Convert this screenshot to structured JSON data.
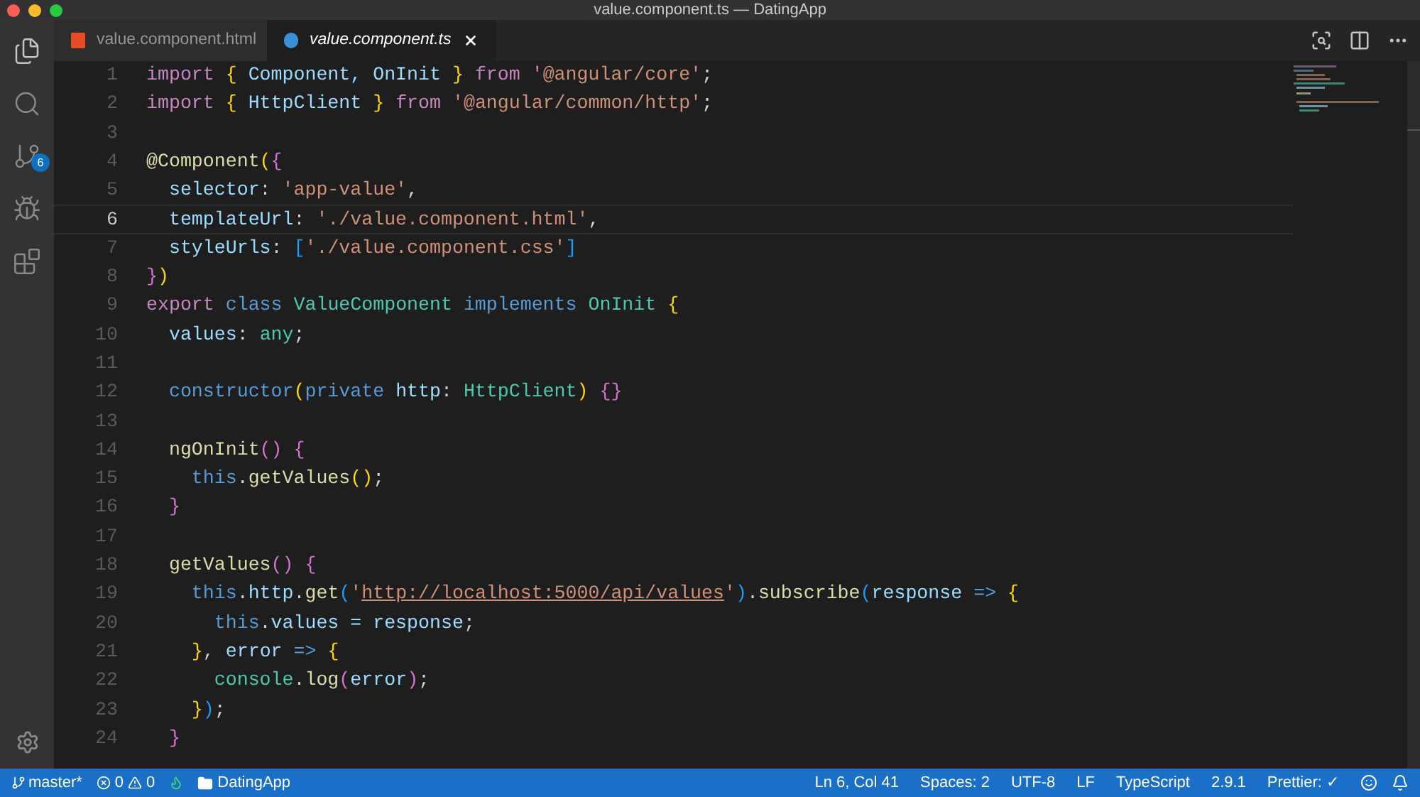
{
  "window": {
    "title": "value.component.ts — DatingApp"
  },
  "activity_bar": {
    "source_control_badge": "6"
  },
  "tabs": [
    {
      "label": "value.component.html",
      "kind": "html",
      "selected": false
    },
    {
      "label": "value.component.ts",
      "kind": "angular",
      "selected": true
    }
  ],
  "editor": {
    "lines": [
      {
        "number": "1",
        "active": false,
        "tokens": [
          {
            "t": "import ",
            "kind": "kw"
          },
          {
            "t": "{ ",
            "kind": "y"
          },
          {
            "t": "Component, OnInit ",
            "kind": "id"
          },
          {
            "t": "} ",
            "kind": "y"
          },
          {
            "t": "from ",
            "kind": "kw"
          },
          {
            "t": "'@angular/core'",
            "kind": "s"
          },
          {
            "t": ";",
            "kind": "p"
          }
        ]
      },
      {
        "number": "2",
        "active": false,
        "tokens": [
          {
            "t": "import ",
            "kind": "kw"
          },
          {
            "t": "{ ",
            "kind": "y"
          },
          {
            "t": "HttpClient ",
            "kind": "id"
          },
          {
            "t": "} ",
            "kind": "y"
          },
          {
            "t": "from ",
            "kind": "kw"
          },
          {
            "t": "'@angular/common/http'",
            "kind": "s"
          },
          {
            "t": ";",
            "kind": "p"
          }
        ]
      },
      {
        "number": "3",
        "active": false
      },
      {
        "number": "4",
        "active": false,
        "tokens": [
          {
            "t": "@Component",
            "kind": "fn"
          },
          {
            "t": "(",
            "kind": "y"
          },
          {
            "t": "{",
            "kind": "m"
          }
        ]
      },
      {
        "number": "5",
        "active": false,
        "tokens": [
          {
            "t": "  selector",
            "kind": "id"
          },
          {
            "t": ": ",
            "kind": "p"
          },
          {
            "t": "'app-value'",
            "kind": "s"
          },
          {
            "t": ",",
            "kind": "p"
          }
        ]
      },
      {
        "number": "6",
        "active": true,
        "tokens": [
          {
            "t": "  templateUrl",
            "kind": "id"
          },
          {
            "t": ": ",
            "kind": "p"
          },
          {
            "t": "'./value.component.html'",
            "kind": "s"
          },
          {
            "t": ",",
            "kind": "p"
          }
        ]
      },
      {
        "number": "7",
        "active": false,
        "tokens": [
          {
            "t": "  styleUrls",
            "kind": "id"
          },
          {
            "t": ": ",
            "kind": "p"
          },
          {
            "t": "[",
            "kind": "b"
          },
          {
            "t": "'./value.component.css'",
            "kind": "s"
          },
          {
            "t": "]",
            "kind": "b"
          }
        ]
      },
      {
        "number": "8",
        "active": false,
        "tokens": [
          {
            "t": "}",
            "kind": "m"
          },
          {
            "t": ")",
            "kind": "y"
          }
        ]
      },
      {
        "number": "9",
        "active": false,
        "tokens": [
          {
            "t": "export ",
            "kind": "kw"
          },
          {
            "t": "class ",
            "kind": "st"
          },
          {
            "t": "ValueComponent ",
            "kind": "t"
          },
          {
            "t": "implements ",
            "kind": "st"
          },
          {
            "t": "OnInit ",
            "kind": "t"
          },
          {
            "t": "{",
            "kind": "y"
          }
        ]
      },
      {
        "number": "10",
        "active": false,
        "tokens": [
          {
            "t": "  values",
            "kind": "id"
          },
          {
            "t": ": ",
            "kind": "p"
          },
          {
            "t": "any",
            "kind": "t"
          },
          {
            "t": ";",
            "kind": "p"
          }
        ]
      },
      {
        "number": "11",
        "active": false
      },
      {
        "number": "12",
        "active": false,
        "tokens": [
          {
            "t": "  constructor",
            "kind": "st"
          },
          {
            "t": "(",
            "kind": "y"
          },
          {
            "t": "private ",
            "kind": "st"
          },
          {
            "t": "http",
            "kind": "id"
          },
          {
            "t": ": ",
            "kind": "p"
          },
          {
            "t": "HttpClient",
            "kind": "t"
          },
          {
            "t": ") ",
            "kind": "y"
          },
          {
            "t": "{}",
            "kind": "m"
          }
        ]
      },
      {
        "number": "13",
        "active": false
      },
      {
        "number": "14",
        "active": false,
        "tokens": [
          {
            "t": "  ngOnInit",
            "kind": "fn"
          },
          {
            "t": "() {",
            "kind": "m"
          }
        ]
      },
      {
        "number": "15",
        "active": false,
        "tokens": [
          {
            "t": "    this",
            "kind": "st"
          },
          {
            "t": ".",
            "kind": "p"
          },
          {
            "t": "getValues",
            "kind": "fn"
          },
          {
            "t": "()",
            "kind": "y"
          },
          {
            "t": ";",
            "kind": "p"
          }
        ]
      },
      {
        "number": "16",
        "active": false,
        "tokens": [
          {
            "t": "  }",
            "kind": "m"
          }
        ]
      },
      {
        "number": "17",
        "active": false
      },
      {
        "number": "18",
        "active": false,
        "tokens": [
          {
            "t": "  getValues",
            "kind": "fn"
          },
          {
            "t": "() {",
            "kind": "m"
          }
        ]
      },
      {
        "number": "19",
        "active": false,
        "tokens": [
          {
            "t": "    this",
            "kind": "st"
          },
          {
            "t": ".",
            "kind": "p"
          },
          {
            "t": "http",
            "kind": "id"
          },
          {
            "t": ".",
            "kind": "p"
          },
          {
            "t": "get",
            "kind": "fn"
          },
          {
            "t": "(",
            "kind": "b"
          },
          {
            "t": "'",
            "kind": "s"
          },
          {
            "t": "http://localhost:5000/api/values",
            "kind": "u"
          },
          {
            "t": "'",
            "kind": "s"
          },
          {
            "t": ")",
            "kind": "b"
          },
          {
            "t": ".",
            "kind": "p"
          },
          {
            "t": "subscribe",
            "kind": "fn"
          },
          {
            "t": "(",
            "kind": "b"
          },
          {
            "t": "response ",
            "kind": "id"
          },
          {
            "t": "=> ",
            "kind": "st"
          },
          {
            "t": "{",
            "kind": "y"
          }
        ]
      },
      {
        "number": "20",
        "active": false,
        "tokens": [
          {
            "t": "      this",
            "kind": "st"
          },
          {
            "t": ".",
            "kind": "p"
          },
          {
            "t": "values = response",
            "kind": "id"
          },
          {
            "t": ";",
            "kind": "p"
          }
        ]
      },
      {
        "number": "21",
        "active": false,
        "tokens": [
          {
            "t": "    }",
            "kind": "y"
          },
          {
            "t": ", ",
            "kind": "p"
          },
          {
            "t": "error ",
            "kind": "id"
          },
          {
            "t": "=> ",
            "kind": "st"
          },
          {
            "t": "{",
            "kind": "y"
          }
        ]
      },
      {
        "number": "22",
        "active": false,
        "tokens": [
          {
            "t": "      console",
            "kind": "t"
          },
          {
            "t": ".",
            "kind": "p"
          },
          {
            "t": "log",
            "kind": "fn"
          },
          {
            "t": "(",
            "kind": "m"
          },
          {
            "t": "error",
            "kind": "id"
          },
          {
            "t": ")",
            "kind": "m"
          },
          {
            "t": ";",
            "kind": "p"
          }
        ]
      },
      {
        "number": "23",
        "active": false,
        "tokens": [
          {
            "t": "    }",
            "kind": "y"
          },
          {
            "t": ")",
            "kind": "b"
          },
          {
            "t": ";",
            "kind": "p"
          }
        ]
      },
      {
        "number": "24",
        "active": false,
        "tokens": [
          {
            "t": "  }",
            "kind": "m"
          }
        ]
      }
    ]
  },
  "status_bar": {
    "branch": "master*",
    "errors": "0",
    "warnings": "0",
    "folder": "DatingApp",
    "right_items": [
      "Ln 6, Col 41",
      "Spaces: 2",
      "UTF-8",
      "LF",
      "TypeScript",
      "2.9.1",
      "Prettier: ✓"
    ]
  }
}
